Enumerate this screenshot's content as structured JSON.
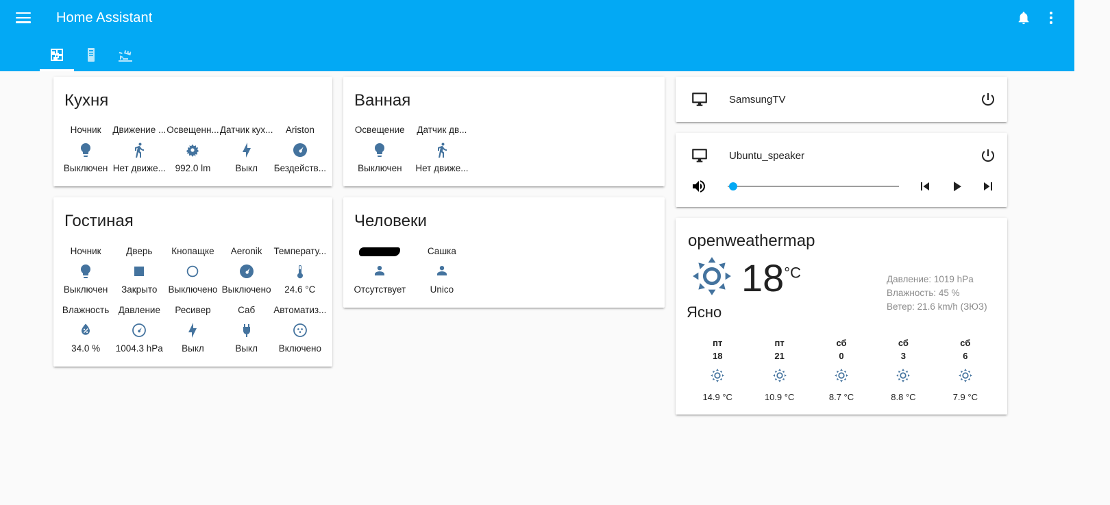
{
  "header": {
    "title": "Home Assistant",
    "menu_icon": "hamburger-menu-icon",
    "notifications_icon": "bell-icon",
    "overflow_icon": "three-dots-vertical-icon",
    "accent_color": "#03a9f4",
    "tabs": [
      {
        "name": "tab-floorplan",
        "icon": "floorplan-icon",
        "active": true
      },
      {
        "name": "tab-server",
        "icon": "server-tower-icon",
        "active": false
      },
      {
        "name": "tab-cameras",
        "icon": "cctv-camera-icon",
        "active": false
      }
    ]
  },
  "cards": {
    "kitchen": {
      "title": "Кухня",
      "entities": [
        {
          "name": "Ночник",
          "icon": "lightbulb-icon",
          "state": "Выключен"
        },
        {
          "name": "Движение ...",
          "icon": "walk-icon",
          "state": "Нет движе..."
        },
        {
          "name": "Освещенн...",
          "icon": "brightness-icon",
          "state": "992.0 lm"
        },
        {
          "name": "Датчик кух...",
          "icon": "flash-icon",
          "state": "Выкл"
        },
        {
          "name": "Ariston",
          "icon": "gauge-icon",
          "state": "Бездейств..."
        }
      ]
    },
    "livingroom": {
      "title": "Гостиная",
      "entities": [
        {
          "name": "Ночник",
          "icon": "lightbulb-icon",
          "state": "Выключен"
        },
        {
          "name": "Дверь",
          "icon": "square-icon",
          "state": "Закрыто"
        },
        {
          "name": "Кнопащке",
          "icon": "circle-outline-icon",
          "state": "Выключено"
        },
        {
          "name": "Aeronik",
          "icon": "gauge-icon",
          "state": "Выключено"
        },
        {
          "name": "Температу...",
          "icon": "thermometer-icon",
          "state": "24.6 °C"
        },
        {
          "name": "Влажность",
          "icon": "water-percent-icon",
          "state": "34.0 %"
        },
        {
          "name": "Давление",
          "icon": "gauge-icon",
          "state": "1004.3 hPa"
        },
        {
          "name": "Ресивер",
          "icon": "flash-icon",
          "state": "Выкл"
        },
        {
          "name": "Саб",
          "icon": "power-plug-icon",
          "state": "Выкл"
        },
        {
          "name": "Автоматиз...",
          "icon": "robot-icon",
          "state": "Включено"
        }
      ]
    },
    "bathroom": {
      "title": "Ванная",
      "entities": [
        {
          "name": "Освещение",
          "icon": "lightbulb-icon",
          "state": "Выключен"
        },
        {
          "name": "Датчик дв...",
          "icon": "walk-icon",
          "state": "Нет движе..."
        }
      ]
    },
    "people": {
      "title": "Человеки",
      "entities": [
        {
          "name": "",
          "redacted": true,
          "icon": "account-icon",
          "state": "Отсутствует"
        },
        {
          "name": "Сашка",
          "redacted": false,
          "icon": "account-icon",
          "state": "Unico"
        }
      ]
    },
    "media_samsung": {
      "name": "SamsungTV",
      "icon": "television-icon",
      "power_icon": "power-icon",
      "has_controls": false
    },
    "media_ubuntu": {
      "name": "Ubuntu_speaker",
      "icon": "television-icon",
      "power_icon": "power-icon",
      "has_controls": true,
      "volume_icon": "volume-high-icon",
      "volume_percent": 3,
      "controls": [
        {
          "name": "previous-track-button",
          "icon": "skip-previous-icon"
        },
        {
          "name": "play-button",
          "icon": "play-icon"
        },
        {
          "name": "next-track-button",
          "icon": "skip-next-icon"
        }
      ]
    },
    "weather": {
      "title": "openweathermap",
      "icon": "sunny-icon",
      "temperature": "18",
      "unit": "°C",
      "condition": "Ясно",
      "details": [
        "Давление: 1019 hPa",
        "Влажность: 45 %",
        "Ветер: 21.6 km/h (ЗЮЗ)"
      ],
      "forecast": [
        {
          "day": "пт",
          "hour": "18",
          "icon": "sunny-icon",
          "temp": "14.9 °C"
        },
        {
          "day": "пт",
          "hour": "21",
          "icon": "sunny-icon",
          "temp": "10.9 °C"
        },
        {
          "day": "сб",
          "hour": "0",
          "icon": "sunny-icon",
          "temp": "8.7 °C"
        },
        {
          "day": "сб",
          "hour": "3",
          "icon": "sunny-icon",
          "temp": "8.8 °C"
        },
        {
          "day": "сб",
          "hour": "6",
          "icon": "sunny-icon",
          "temp": "7.9 °C"
        }
      ]
    }
  }
}
